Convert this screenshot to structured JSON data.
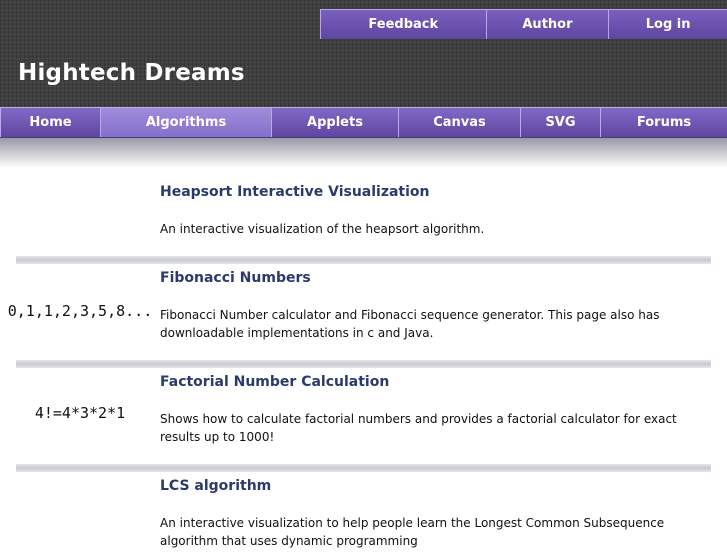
{
  "top_nav": {
    "items": [
      {
        "label": "Feedback"
      },
      {
        "label": "Author"
      },
      {
        "label": "Log in"
      }
    ]
  },
  "site": {
    "title": "Hightech Dreams"
  },
  "main_nav": {
    "items": [
      {
        "label": "Home"
      },
      {
        "label": "Algorithms",
        "active": true
      },
      {
        "label": "Applets"
      },
      {
        "label": "Canvas"
      },
      {
        "label": "SVG"
      },
      {
        "label": "Forums"
      }
    ]
  },
  "colors": {
    "nav_purple": "#6b52b0",
    "nav_active": "#927dd4",
    "title_link": "#2c3a6b",
    "header_bg": "#3f3f3f"
  },
  "entries": [
    {
      "thumb": "",
      "title": "Heapsort Interactive Visualization",
      "desc": "An interactive visualization of the heapsort algorithm."
    },
    {
      "thumb": "0,1,1,2,3,5,8...",
      "title": "Fibonacci Numbers",
      "desc": "Fibonacci Number calculator and Fibonacci sequence generator. This page also has downloadable implementations in c and Java."
    },
    {
      "thumb": "4!=4*3*2*1",
      "title": "Factorial Number Calculation",
      "desc": "Shows how to calculate factorial numbers and provides a factorial calculator for exact results up to 1000!"
    },
    {
      "thumb": "",
      "title": "LCS algorithm",
      "desc": "An interactive visualization to help people learn the Longest Common Subsequence algorithm that uses dynamic programming"
    }
  ]
}
